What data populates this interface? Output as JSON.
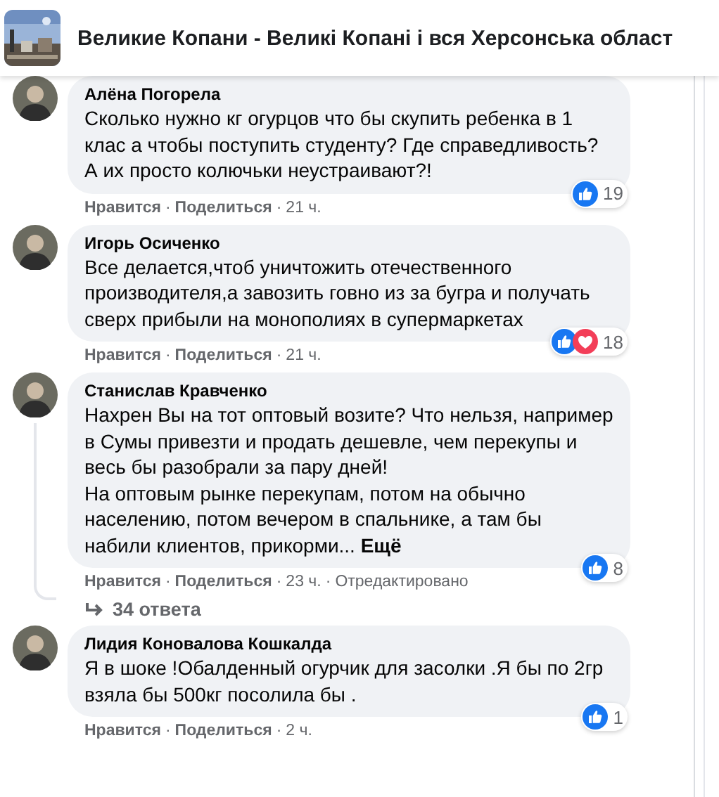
{
  "header": {
    "title": "Великие Копани - Великі Копані і вся Херсонська област"
  },
  "comments": [
    {
      "author": "Алёна Погорела",
      "text": "Сколько нужно кг огурцов что бы скупить ребенка в 1 клас а чтобы поступить студенту? Где справедливость? А их просто колючьки неустраивают?!",
      "reactions": [
        {
          "kind": "like"
        }
      ],
      "reaction_count": "19",
      "actions": [
        {
          "kind": "link",
          "text": "Нравится"
        },
        {
          "kind": "dot",
          "text": "·"
        },
        {
          "kind": "link",
          "text": "Поделиться"
        },
        {
          "kind": "dot",
          "text": "·"
        },
        {
          "kind": "time",
          "text": "21 ч."
        }
      ]
    },
    {
      "author": "Игорь Осиченко",
      "text": "Все делается,чтоб уничтожить отечественного производителя,а завозить говно из за бугра и получать сверх прибыли на монополиях в супермаркетах",
      "reactions": [
        {
          "kind": "like"
        },
        {
          "kind": "love"
        }
      ],
      "reaction_count": "18",
      "actions": [
        {
          "kind": "link",
          "text": "Нравится"
        },
        {
          "kind": "dot",
          "text": "·"
        },
        {
          "kind": "link",
          "text": "Поделиться"
        },
        {
          "kind": "dot",
          "text": "·"
        },
        {
          "kind": "time",
          "text": "21 ч."
        }
      ]
    },
    {
      "author": "Станислав Кравченко",
      "text": "Нахрен Вы на тот оптовый возите? Что нельзя, например в Сумы привезти и продать дешевле, чем перекупы и весь бы разобрали за пару дней!\nНа оптовым рынке перекупам, потом на обычно населению, потом вечером в спальнике, а там бы набили клиентов, прикорми... **Ещё**",
      "reactions": [
        {
          "kind": "like"
        }
      ],
      "reaction_count": "8",
      "actions": [
        {
          "kind": "link",
          "text": "Нравится"
        },
        {
          "kind": "dot",
          "text": "·"
        },
        {
          "kind": "link",
          "text": "Поделиться"
        },
        {
          "kind": "dot",
          "text": "·"
        },
        {
          "kind": "time",
          "text": "23 ч."
        },
        {
          "kind": "dot",
          "text": "·"
        },
        {
          "kind": "time",
          "text": "Отредактировано"
        }
      ],
      "replies": "34 ответа"
    },
    {
      "author": "Лидия Коновалова Кошкалда",
      "text": "Я в шоке !Обалденный огурчик для засолки .Я бы по 2гр взяла бы 500кг посолила бы .",
      "reactions": [
        {
          "kind": "like"
        }
      ],
      "reaction_count": "1",
      "actions": [
        {
          "kind": "link",
          "text": "Нравится"
        },
        {
          "kind": "dot",
          "text": "·"
        },
        {
          "kind": "link",
          "text": "Поделиться"
        },
        {
          "kind": "dot",
          "text": "·"
        },
        {
          "kind": "time",
          "text": "2 ч."
        }
      ]
    }
  ]
}
